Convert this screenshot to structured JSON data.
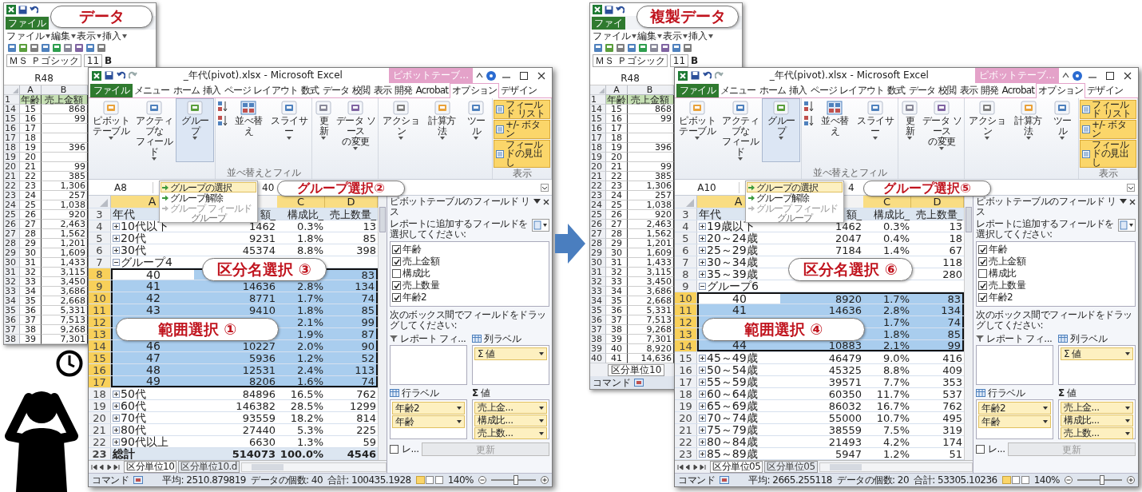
{
  "panels": [
    {
      "data_window": {
        "callout": "データ",
        "tab": "ファイル",
        "menus": [
          "ファイル",
          "編集",
          "表示",
          "挿入"
        ],
        "font": "ＭＳ Ｐゴシック",
        "size": "11",
        "bold": "B",
        "name_box": "R48",
        "columns": [
          "A",
          "B"
        ],
        "header_num": "1",
        "header": [
          "年齢",
          "売上金額"
        ],
        "rows": [
          {
            "num": "14",
            "a": "15",
            "b": "868"
          },
          {
            "num": "15",
            "a": "16",
            "b": "99"
          },
          {
            "num": "16",
            "a": "17"
          },
          {
            "num": "17",
            "a": "18"
          },
          {
            "num": "18",
            "a": "19",
            "b": "396"
          },
          {
            "num": "19",
            "a": "20"
          },
          {
            "num": "20",
            "a": "21",
            "b": "99"
          },
          {
            "num": "21",
            "a": "22",
            "b": "385"
          },
          {
            "num": "22",
            "a": "23",
            "b": "1,306"
          },
          {
            "num": "23",
            "a": "24",
            "b": "257"
          },
          {
            "num": "24",
            "a": "25",
            "b": "1,038"
          },
          {
            "num": "25",
            "a": "26",
            "b": "920"
          },
          {
            "num": "26",
            "a": "27",
            "b": "2,463"
          },
          {
            "num": "27",
            "a": "28",
            "b": "1,562"
          },
          {
            "num": "28",
            "a": "29",
            "b": "1,201"
          },
          {
            "num": "29",
            "a": "30",
            "b": "1,609"
          },
          {
            "num": "30",
            "a": "31",
            "b": "1,433"
          },
          {
            "num": "31",
            "a": "32",
            "b": "3,115"
          },
          {
            "num": "32",
            "a": "33",
            "b": "3,450"
          },
          {
            "num": "33",
            "a": "34",
            "b": "3,686"
          },
          {
            "num": "34",
            "a": "35",
            "b": "2,668"
          },
          {
            "num": "35",
            "a": "36",
            "b": "5,331"
          },
          {
            "num": "36",
            "a": "37",
            "b": "7,513"
          },
          {
            "num": "37",
            "a": "38",
            "b": "9,268"
          },
          {
            "num": "38",
            "a": "39",
            "b": "7,301"
          }
        ]
      },
      "pivot": {
        "title": "_年代(pivot).xlsx - Microsoft Excel",
        "context_tab": "ピボットテーブ...",
        "tabs": [
          {
            "label": "ファイル",
            "kind": "file",
            "selected": false
          },
          {
            "label": "メニュー",
            "kind": "tab",
            "selected": false
          },
          {
            "label": "ホーム",
            "kind": "tab",
            "selected": false
          },
          {
            "label": "挿入",
            "kind": "tab",
            "selected": false
          },
          {
            "label": "ページ レイアウト",
            "kind": "tab",
            "selected": false
          },
          {
            "label": "数式",
            "kind": "tab",
            "selected": false
          },
          {
            "label": "データ",
            "kind": "tab",
            "selected": false
          },
          {
            "label": "校閲",
            "kind": "tab",
            "selected": false
          },
          {
            "label": "表示",
            "kind": "tab",
            "selected": false
          },
          {
            "label": "開発",
            "kind": "tab",
            "selected": false
          },
          {
            "label": "Acrobat",
            "kind": "tab",
            "selected": false
          },
          {
            "label": "オプション",
            "kind": "tab",
            "selected": true
          },
          {
            "label": "デザイン",
            "kind": "tab",
            "selected": false
          }
        ],
        "ribbon": {
          "groups": [
            {
              "items": [
                {
                  "kind": "button",
                  "lines": [
                    "ピボットテーブル"
                  ],
                  "dropdown": true,
                  "pressed": false
                },
                {
                  "kind": "button",
                  "lines": [
                    "アクティブな",
                    "フィールド"
                  ],
                  "dropdown": true,
                  "pressed": false
                },
                {
                  "kind": "button",
                  "lines": [
                    "グループ"
                  ],
                  "dropdown": true,
                  "pressed": true
                }
              ]
            },
            {
              "label": "並べ替えとフィル",
              "items": [
                {
                  "kind": "sort",
                  "lines": [
                    "並べ替え"
                  ],
                  "dropdown": false,
                  "pressed": false
                },
                {
                  "kind": "button",
                  "lines": [
                    "スライサー"
                  ],
                  "dropdown": true,
                  "pressed": false
                }
              ]
            },
            {
              "items": [
                {
                  "kind": "button",
                  "lines": [
                    "更新"
                  ],
                  "dropdown": true,
                  "pressed": false
                },
                {
                  "kind": "button",
                  "lines": [
                    "データ ソース",
                    "の変更"
                  ],
                  "dropdown": true,
                  "pressed": false
                }
              ]
            },
            {
              "items": [
                {
                  "kind": "button",
                  "lines": [
                    "アクション"
                  ],
                  "dropdown": true,
                  "pressed": false
                },
                {
                  "kind": "button",
                  "lines": [
                    "計算方法"
                  ],
                  "dropdown": true,
                  "pressed": false
                },
                {
                  "kind": "button",
                  "lines": [
                    "ツール"
                  ],
                  "dropdown": true,
                  "pressed": false
                }
              ]
            }
          ],
          "show": {
            "label": "表示",
            "buttons": [
              {
                "label": "フィールド リスト",
                "on": true
              },
              {
                "label": "+/- ボタン",
                "on": true
              },
              {
                "label": "フィールドの見出し",
                "on": true
              }
            ]
          }
        },
        "menu": {
          "items": [
            {
              "label": "グループの選択",
              "highlighted": true,
              "disabled": false
            },
            {
              "label": "グループ解除",
              "highlighted": false,
              "disabled": false
            },
            {
              "label": "グループ フィールド",
              "highlighted": false,
              "disabled": true
            }
          ],
          "label": "グループ"
        },
        "name_box": "A8",
        "formula": "40",
        "columns": [
          "A",
          null,
          "C",
          "D"
        ],
        "rows": [
          {
            "num": "3",
            "kind": "header",
            "selected": false,
            "cells": [
              "年代",
              "額_",
              "構成比_",
              "売上数量_"
            ]
          },
          {
            "num": "4",
            "kind": "collapsed",
            "selected": false,
            "cells": [
              "10代以下",
              "1462",
              "0.3%",
              "13"
            ]
          },
          {
            "num": "5",
            "kind": "collapsed",
            "selected": false,
            "cells": [
              "20代",
              "9231",
              "1.8%",
              "85"
            ]
          },
          {
            "num": "6",
            "kind": "collapsed",
            "selected": false,
            "cells": [
              "30代",
              "45374",
              "8.8%",
              "398"
            ]
          },
          {
            "num": "7",
            "kind": "expanded",
            "selected": false,
            "cells": [
              "グループ4",
              null,
              null,
              null
            ]
          },
          {
            "num": "8",
            "kind": "item",
            "selected": true,
            "cells": [
              "40",
              null,
              null,
              "83"
            ]
          },
          {
            "num": "9",
            "kind": "item",
            "selected": true,
            "cells": [
              "41",
              "14636",
              "2.8%",
              "134"
            ]
          },
          {
            "num": "10",
            "kind": "item",
            "selected": true,
            "cells": [
              "42",
              "8771",
              "1.7%",
              "74"
            ]
          },
          {
            "num": "11",
            "kind": "item",
            "selected": true,
            "cells": [
              "43",
              "9410",
              "1.8%",
              "85"
            ]
          },
          {
            "num": "12",
            "kind": "item",
            "selected": true,
            "cells": [
              null,
              null,
              "2.1%",
              "99"
            ]
          },
          {
            "num": "13",
            "kind": "item",
            "selected": true,
            "cells": [
              null,
              null,
              "1.9%",
              "87"
            ]
          },
          {
            "num": "14",
            "kind": "item",
            "selected": true,
            "cells": [
              "46",
              "10227",
              "2.0%",
              "90"
            ]
          },
          {
            "num": "15",
            "kind": "item",
            "selected": true,
            "cells": [
              "47",
              "5936",
              "1.2%",
              "52"
            ]
          },
          {
            "num": "16",
            "kind": "item",
            "selected": true,
            "cells": [
              "48",
              "12531",
              "2.4%",
              "113"
            ]
          },
          {
            "num": "17",
            "kind": "item",
            "selected": true,
            "cells": [
              "49",
              "8206",
              "1.6%",
              "74"
            ]
          },
          {
            "num": "18",
            "kind": "collapsed",
            "selected": false,
            "cells": [
              "50代",
              "84896",
              "16.5%",
              "762"
            ]
          },
          {
            "num": "19",
            "kind": "collapsed",
            "selected": false,
            "cells": [
              "60代",
              "146382",
              "28.5%",
              "1299"
            ]
          },
          {
            "num": "20",
            "kind": "collapsed",
            "selected": false,
            "cells": [
              "70代",
              "93559",
              "18.2%",
              "814"
            ]
          },
          {
            "num": "21",
            "kind": "collapsed",
            "selected": false,
            "cells": [
              "80代",
              "27440",
              "5.3%",
              "225"
            ]
          },
          {
            "num": "22",
            "kind": "collapsed",
            "selected": false,
            "cells": [
              "90代以上",
              "6630",
              "1.3%",
              "59"
            ]
          },
          {
            "num": "23",
            "kind": "total",
            "selected": false,
            "cells": [
              "総計",
              "514073",
              "100.0%",
              "4546"
            ]
          }
        ],
        "sheet_tabs": [
          {
            "label": "区分単位10",
            "selected": true
          },
          {
            "label": "区分単位10.d",
            "selected": false
          }
        ],
        "status": {
          "mode": "コマンド",
          "average": "平均: 2510.879819",
          "count": "データの個数: 40",
          "sum": "合計: 100435.1928",
          "zoom": "140%",
          "zoom_slider": {
            "level": 0.55
          }
        },
        "field_list": {
          "title": "ピボットテーブルのフィールド リス",
          "prompt": "レポートに追加するフィールドを選択してください:",
          "fields": [
            {
              "label": "年齢",
              "checked": true
            },
            {
              "label": "売上金額",
              "checked": true
            },
            {
              "label": "構成比",
              "checked": false
            },
            {
              "label": "売上数量",
              "checked": true
            },
            {
              "label": "年齢2",
              "checked": true
            }
          ],
          "drag_prompt": "次のボックス間でフィールドをドラッグしてください:",
          "areas": [
            {
              "kind": "filter",
              "label": "レポート フィ..."
            },
            {
              "kind": "columns",
              "label": "列ラベル",
              "items": [
                "Σ 値"
              ]
            },
            {
              "kind": "rows",
              "label": "行ラベル",
              "items": [
                "年齢2",
                "年齢"
              ]
            },
            {
              "kind": "values",
              "symbol": "Σ",
              "label": "値",
              "items": [
                "売上金...",
                "構成比...",
                "売上数..."
              ]
            }
          ],
          "defer": {
            "label": "レ...",
            "checked": false
          },
          "update": {
            "label": "更新",
            "disabled": true
          }
        },
        "callouts": [
          {
            "kind": "group",
            "text": "グループ選択②"
          },
          {
            "kind": "name",
            "text": "区分名選択 ③"
          },
          {
            "kind": "range",
            "text": "範囲選択 ①"
          }
        ]
      }
    },
    {
      "data_window": {
        "callout": "複製データ",
        "tab": "ファイ",
        "menus": [
          "ファイル",
          "編集",
          "表示",
          "挿入"
        ],
        "font": "ＭＳ Ｐゴシック",
        "size": "11",
        "bold": "B",
        "name_box": "R48",
        "columns": [
          "A",
          "B"
        ],
        "header_num": "1",
        "header": [
          "年齢",
          "売上金額"
        ],
        "rows": [
          {
            "num": "14",
            "a": "15",
            "b": "868"
          },
          {
            "num": "15",
            "a": "16",
            "b": "99"
          },
          {
            "num": "16",
            "a": "17"
          },
          {
            "num": "17",
            "a": "18"
          },
          {
            "num": "18",
            "a": "19",
            "b": "396"
          },
          {
            "num": "19",
            "a": "20"
          },
          {
            "num": "20",
            "a": "21",
            "b": "99"
          },
          {
            "num": "21",
            "a": "22",
            "b": "385"
          },
          {
            "num": "22",
            "a": "23",
            "b": "1,306"
          },
          {
            "num": "23",
            "a": "24",
            "b": "257"
          },
          {
            "num": "24",
            "a": "25",
            "b": "1,038"
          },
          {
            "num": "25",
            "a": "26",
            "b": "920"
          },
          {
            "num": "26",
            "a": "27",
            "b": "2,463"
          },
          {
            "num": "27",
            "a": "28",
            "b": "1,562"
          },
          {
            "num": "28",
            "a": "29",
            "b": "1,201"
          },
          {
            "num": "29",
            "a": "30",
            "b": "1,609"
          },
          {
            "num": "30",
            "a": "31",
            "b": "1,433"
          },
          {
            "num": "31",
            "a": "32",
            "b": "3,115"
          },
          {
            "num": "32",
            "a": "33",
            "b": "3,450"
          },
          {
            "num": "33",
            "a": "34",
            "b": "3,686"
          },
          {
            "num": "34",
            "a": "35",
            "b": "2,668"
          },
          {
            "num": "35",
            "a": "36",
            "b": "5,331"
          },
          {
            "num": "36",
            "a": "37",
            "b": "7,513"
          },
          {
            "num": "37",
            "a": "38",
            "b": "9,268"
          },
          {
            "num": "38",
            "a": "39",
            "b": "7,301"
          },
          {
            "num": "39",
            "a": "40",
            "b": "8,920"
          },
          {
            "num": "40",
            "a": "41",
            "b": "14,636"
          }
        ],
        "sheet_tab": "区分単位10",
        "status": "コマンド"
      },
      "pivot": {
        "title": "_年代(pivot).xlsx - Microsoft Excel",
        "context_tab": "ピボットテーブ...",
        "tabs": [
          {
            "label": "ファイル",
            "kind": "file",
            "selected": false
          },
          {
            "label": "メニュー",
            "kind": "tab",
            "selected": false
          },
          {
            "label": "ホーム",
            "kind": "tab",
            "selected": false
          },
          {
            "label": "挿入",
            "kind": "tab",
            "selected": false
          },
          {
            "label": "ページ レイアウト",
            "kind": "tab",
            "selected": false
          },
          {
            "label": "数式",
            "kind": "tab",
            "selected": false
          },
          {
            "label": "データ",
            "kind": "tab",
            "selected": false
          },
          {
            "label": "校閲",
            "kind": "tab",
            "selected": false
          },
          {
            "label": "表示",
            "kind": "tab",
            "selected": false
          },
          {
            "label": "開発",
            "kind": "tab",
            "selected": false
          },
          {
            "label": "Acrobat",
            "kind": "tab",
            "selected": false
          },
          {
            "label": "オプション",
            "kind": "tab",
            "selected": true
          },
          {
            "label": "デザイン",
            "kind": "tab",
            "selected": false
          }
        ],
        "ribbon": {
          "groups": [
            {
              "items": [
                {
                  "kind": "button",
                  "lines": [
                    "ピボットテーブル"
                  ],
                  "dropdown": true,
                  "pressed": false
                },
                {
                  "kind": "button",
                  "lines": [
                    "アクティブな",
                    "フィールド"
                  ],
                  "dropdown": true,
                  "pressed": false
                },
                {
                  "kind": "button",
                  "lines": [
                    "グループ"
                  ],
                  "dropdown": true,
                  "pressed": true
                }
              ]
            },
            {
              "label": "並べ替えとフィル",
              "items": [
                {
                  "kind": "sort",
                  "lines": [
                    "並べ替え"
                  ],
                  "dropdown": false,
                  "pressed": false
                },
                {
                  "kind": "button",
                  "lines": [
                    "スライサー"
                  ],
                  "dropdown": true,
                  "pressed": false
                }
              ]
            },
            {
              "items": [
                {
                  "kind": "button",
                  "lines": [
                    "更新"
                  ],
                  "dropdown": true,
                  "pressed": false
                },
                {
                  "kind": "button",
                  "lines": [
                    "データ ソース",
                    "の変更"
                  ],
                  "dropdown": true,
                  "pressed": false
                }
              ]
            },
            {
              "items": [
                {
                  "kind": "button",
                  "lines": [
                    "アクション"
                  ],
                  "dropdown": true,
                  "pressed": false
                },
                {
                  "kind": "button",
                  "lines": [
                    "計算方法"
                  ],
                  "dropdown": true,
                  "pressed": false
                },
                {
                  "kind": "button",
                  "lines": [
                    "ツール"
                  ],
                  "dropdown": true,
                  "pressed": false
                }
              ]
            }
          ],
          "show": {
            "label": "表示",
            "buttons": [
              {
                "label": "フィールド リスト",
                "on": true
              },
              {
                "label": "+/- ボタン",
                "on": true
              },
              {
                "label": "フィールドの見出し",
                "on": true
              }
            ]
          }
        },
        "menu": {
          "items": [
            {
              "label": "グループの選択",
              "highlighted": true,
              "disabled": false
            },
            {
              "label": "グループ解除",
              "highlighted": false,
              "disabled": false
            },
            {
              "label": "グループ フィールド",
              "highlighted": false,
              "disabled": true
            }
          ],
          "label": "グループ"
        },
        "name_box": "A10",
        "formula": "4",
        "columns": [
          "A",
          null,
          "C",
          "D"
        ],
        "rows": [
          {
            "num": "3",
            "kind": "header",
            "selected": false,
            "cells": [
              "年代",
              "額_",
              "構成比_",
              "売上数量_"
            ]
          },
          {
            "num": "4",
            "kind": "collapsed",
            "selected": false,
            "cells": [
              "19歳以下",
              "1462",
              "0.3%",
              "13"
            ]
          },
          {
            "num": "5",
            "kind": "collapsed",
            "selected": false,
            "cells": [
              "20～24歳",
              "2047",
              "0.4%",
              "18"
            ]
          },
          {
            "num": "6",
            "kind": "collapsed",
            "selected": false,
            "cells": [
              "25～29歳",
              "7184",
              "1.4%",
              "67"
            ]
          },
          {
            "num": "7",
            "kind": "collapsed",
            "selected": false,
            "cells": [
              "30～34歳",
              null,
              null,
              "118"
            ]
          },
          {
            "num": "8",
            "kind": "collapsed",
            "selected": false,
            "cells": [
              "35～39歳",
              null,
              null,
              "280"
            ]
          },
          {
            "num": "9",
            "kind": "expanded",
            "selected": false,
            "cells": [
              "グループ6",
              null,
              null,
              null
            ]
          },
          {
            "num": "10",
            "kind": "item",
            "selected": true,
            "cells": [
              "40",
              "8920",
              "1.7%",
              "83"
            ]
          },
          {
            "num": "11",
            "kind": "item",
            "selected": true,
            "cells": [
              "41",
              "14636",
              "2.8%",
              "134"
            ]
          },
          {
            "num": "12",
            "kind": "item",
            "selected": true,
            "cells": [
              null,
              null,
              "1.7%",
              "74"
            ]
          },
          {
            "num": "13",
            "kind": "item",
            "selected": true,
            "cells": [
              null,
              null,
              "1.8%",
              "85"
            ]
          },
          {
            "num": "14",
            "kind": "item",
            "selected": true,
            "cells": [
              "44",
              "10883",
              "2.1%",
              "99"
            ]
          },
          {
            "num": "15",
            "kind": "collapsed",
            "selected": false,
            "cells": [
              "45～49歳",
              "46479",
              "9.0%",
              "416"
            ]
          },
          {
            "num": "16",
            "kind": "collapsed",
            "selected": false,
            "cells": [
              "50～54歳",
              "45325",
              "8.8%",
              "409"
            ]
          },
          {
            "num": "17",
            "kind": "collapsed",
            "selected": false,
            "cells": [
              "55～59歳",
              "39571",
              "7.7%",
              "353"
            ]
          },
          {
            "num": "18",
            "kind": "collapsed",
            "selected": false,
            "cells": [
              "60～64歳",
              "60350",
              "11.7%",
              "537"
            ]
          },
          {
            "num": "19",
            "kind": "collapsed",
            "selected": false,
            "cells": [
              "65～69歳",
              "86032",
              "16.7%",
              "762"
            ]
          },
          {
            "num": "20",
            "kind": "collapsed",
            "selected": false,
            "cells": [
              "70～74歳",
              "55000",
              "10.7%",
              "495"
            ]
          },
          {
            "num": "21",
            "kind": "collapsed",
            "selected": false,
            "cells": [
              "75～79歳",
              "38559",
              "7.5%",
              "319"
            ]
          },
          {
            "num": "22",
            "kind": "collapsed",
            "selected": false,
            "cells": [
              "80～84歳",
              "21493",
              "4.2%",
              "174"
            ]
          },
          {
            "num": "23",
            "kind": "collapsed",
            "selected": false,
            "cells": [
              "85～89歳",
              "5947",
              "1.2%",
              "51"
            ]
          }
        ],
        "sheet_tabs": [
          {
            "label": "区分単位05",
            "selected": true
          },
          {
            "label": "区分単位05",
            "selected": false
          }
        ],
        "status": {
          "mode": "コマンド",
          "average": "平均: 2665.255118",
          "count": "データの個数: 20",
          "sum": "合計: 53305.10236",
          "zoom": "140%",
          "zoom_slider": {
            "level": 0.55
          }
        },
        "field_list": {
          "title": "ピボットテーブルのフィールド リス",
          "prompt": "レポートに追加するフィールドを選択してください:",
          "fields": [
            {
              "label": "年齢",
              "checked": true
            },
            {
              "label": "売上金額",
              "checked": true
            },
            {
              "label": "構成比",
              "checked": false
            },
            {
              "label": "売上数量",
              "checked": true
            },
            {
              "label": "年齢2",
              "checked": true
            }
          ],
          "drag_prompt": "次のボックス間でフィールドをドラッグしてください:",
          "areas": [
            {
              "kind": "filter",
              "label": "レポート フィ..."
            },
            {
              "kind": "columns",
              "label": "列ラベル",
              "items": [
                "Σ 値"
              ]
            },
            {
              "kind": "rows",
              "label": "行ラベル",
              "items": [
                "年齢2",
                "年齢"
              ]
            },
            {
              "kind": "values",
              "symbol": "Σ",
              "label": "値",
              "items": [
                "売上金...",
                "構成比...",
                "売上数..."
              ]
            }
          ],
          "defer": {
            "label": "レ...",
            "checked": false
          },
          "update": {
            "label": "更新",
            "disabled": true
          }
        },
        "callouts": [
          {
            "kind": "group",
            "text": "グループ選択⑤"
          },
          {
            "kind": "name",
            "text": "区分名選択 ⑥"
          },
          {
            "kind": "range",
            "text": "範囲選択 ④"
          }
        ]
      }
    }
  ]
}
